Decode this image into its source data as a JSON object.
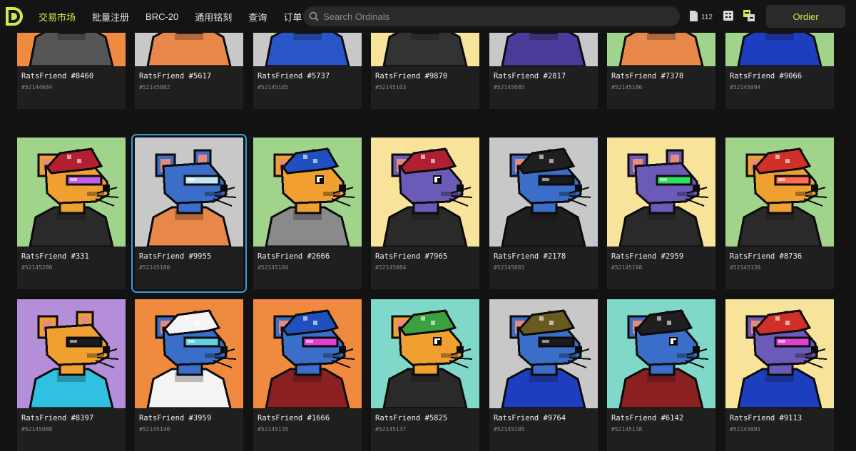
{
  "nav": {
    "items": [
      "交易市场",
      "批量注册",
      "BRC-20",
      "通用铭刻",
      "查询",
      "订单"
    ],
    "active_index": 0
  },
  "search": {
    "placeholder": "Search Ordinals"
  },
  "header": {
    "inscription_count": "112",
    "connect_label": "Ordier"
  },
  "colors": {
    "accent": "#d7e84a",
    "selected_outline": "#3a9ad9"
  },
  "selected": "RatsFriend #9955",
  "cards": [
    {
      "name": "RatsFriend #8460",
      "number": "#52144684",
      "bg": "#f08a3e",
      "fur": "#f0a030",
      "shirt": "#555555",
      "hat": "",
      "glasses": ""
    },
    {
      "name": "RatsFriend #5617",
      "number": "#52145082",
      "bg": "#c8c8c8",
      "fur": "#f0a030",
      "shirt": "#e8874a",
      "hat": "",
      "glasses": ""
    },
    {
      "name": "RatsFriend #5737",
      "number": "#52145185",
      "bg": "#c8c8c8",
      "fur": "#f0a030",
      "shirt": "#2a55c8",
      "hat": "",
      "glasses": ""
    },
    {
      "name": "RatsFriend #9870",
      "number": "#52145103",
      "bg": "#f8e39a",
      "fur": "#3a6ec8",
      "shirt": "#333333",
      "hat": "",
      "glasses": ""
    },
    {
      "name": "RatsFriend #2817",
      "number": "#52145085",
      "bg": "#c8c8c8",
      "fur": "#6c5ab8",
      "shirt": "#4a3a9a",
      "hat": "",
      "glasses": ""
    },
    {
      "name": "RatsFriend #7378",
      "number": "#52145186",
      "bg": "#9fd48a",
      "fur": "#f0a030",
      "shirt": "#e8874a",
      "hat": "",
      "glasses": ""
    },
    {
      "name": "RatsFriend #9066",
      "number": "#52145094",
      "bg": "#9fd48a",
      "fur": "#6c5ab8",
      "shirt": "#1e3ec0",
      "hat": "",
      "glasses": ""
    },
    {
      "name": "RatsFriend #331",
      "number": "#52145280",
      "bg": "#9fd48a",
      "fur": "#f0a030",
      "shirt": "#2a2a2a",
      "hat": "#b02030",
      "glasses": "#c060e8"
    },
    {
      "name": "RatsFriend #9955",
      "number": "#52145180",
      "bg": "#c8c8c8",
      "fur": "#3a6ec8",
      "shirt": "#e8874a",
      "hat": "",
      "glasses": "#bfe8f0"
    },
    {
      "name": "RatsFriend #2666",
      "number": "#52145184",
      "bg": "#9fd48a",
      "fur": "#f0a030",
      "shirt": "#8a8a8a",
      "hat": "#2050c0",
      "glasses": ""
    },
    {
      "name": "RatsFriend #7965",
      "number": "#52145084",
      "bg": "#f8e39a",
      "fur": "#6c5ab8",
      "shirt": "#2a2a2a",
      "hat": "#b02030",
      "glasses": ""
    },
    {
      "name": "RatsFriend #2178",
      "number": "#52145083",
      "bg": "#c8c8c8",
      "fur": "#3a6ec8",
      "shirt": "#1f1f1f",
      "hat": "#1f1f1f",
      "glasses": "#1a1a1a"
    },
    {
      "name": "RatsFriend #2959",
      "number": "#52145198",
      "bg": "#f8e39a",
      "fur": "#6c5ab8",
      "shirt": "#2a2a2a",
      "hat": "",
      "glasses": "#30e060"
    },
    {
      "name": "RatsFriend #8736",
      "number": "#52145139",
      "bg": "#9fd48a",
      "fur": "#f0a030",
      "shirt": "#2a2a2a",
      "hat": "#d03028",
      "glasses": "#ff6a50"
    },
    {
      "name": "RatsFriend #8397",
      "number": "#52145088",
      "bg": "#b48ed8",
      "fur": "#f0a030",
      "shirt": "#30c0e0",
      "hat": "",
      "glasses": "#1a1a1a"
    },
    {
      "name": "RatsFriend #3959",
      "number": "#52145140",
      "bg": "#f08a3e",
      "fur": "#3a6ec8",
      "shirt": "#f4f4f4",
      "hat": "#f4f4f4",
      "glasses": "#60d0e0"
    },
    {
      "name": "RatsFriend #1666",
      "number": "#52145135",
      "bg": "#f08a3e",
      "fur": "#3a6ec8",
      "shirt": "#8a2020",
      "hat": "#2050c0",
      "glasses": "#e040d0"
    },
    {
      "name": "RatsFriend #5825",
      "number": "#52145137",
      "bg": "#7fd8c8",
      "fur": "#f0a030",
      "shirt": "#2a2a2a",
      "hat": "#3aa040",
      "glasses": ""
    },
    {
      "name": "RatsFriend #9764",
      "number": "#52145105",
      "bg": "#c8c8c8",
      "fur": "#3a6ec8",
      "shirt": "#1e3ec0",
      "hat": "#6a5a20",
      "glasses": "#1a1a1a"
    },
    {
      "name": "RatsFriend #6142",
      "number": "#52145138",
      "bg": "#7fd8c8",
      "fur": "#3a6ec8",
      "shirt": "#8a2020",
      "hat": "#1f1f1f",
      "glasses": ""
    },
    {
      "name": "RatsFriend #9113",
      "number": "#52145091",
      "bg": "#f8e39a",
      "fur": "#6c5ab8",
      "shirt": "#1e3ec0",
      "hat": "#d03028",
      "glasses": "#e040d0"
    }
  ]
}
